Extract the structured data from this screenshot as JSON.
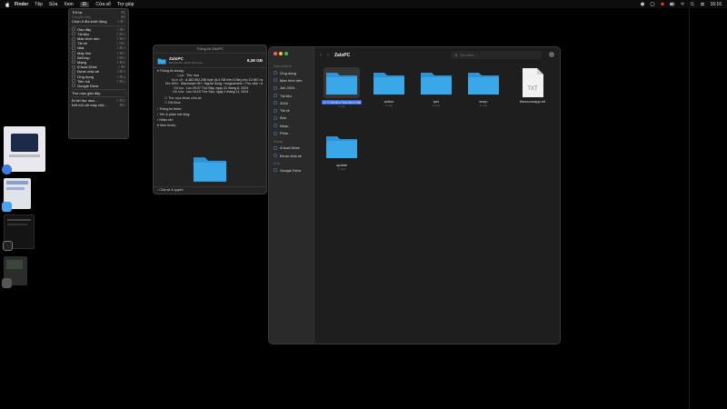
{
  "menubar": {
    "app": "Finder",
    "items": [
      "Tệp",
      "Sửa",
      "Xem",
      "Đi",
      "Cửa sổ",
      "Trợ giúp"
    ],
    "active_index": 3,
    "time": "16:16"
  },
  "go_menu": {
    "rows": [
      {
        "label": "Trở lại",
        "shortcut": "⌘[",
        "dim": false,
        "icon": ""
      },
      {
        "label": "Chuyển tiếp",
        "shortcut": "⌘]",
        "dim": true,
        "icon": ""
      },
      {
        "label": "Chọn ổ đĩa khởi động",
        "shortcut": "⇧⌘↑",
        "dim": false,
        "icon": ""
      },
      {
        "sep": true
      },
      {
        "label": "Gần đây",
        "shortcut": "⇧⌘F",
        "dim": false,
        "icon": "clock-icon"
      },
      {
        "label": "Tài liệu",
        "shortcut": "⇧⌘O",
        "dim": false,
        "icon": "document-icon"
      },
      {
        "label": "Màn hình nền",
        "shortcut": "⇧⌘D",
        "dim": false,
        "icon": "desktop-icon"
      },
      {
        "label": "Tải về",
        "shortcut": "⌥⌘L",
        "dim": false,
        "icon": "download-icon"
      },
      {
        "label": "Nhà",
        "shortcut": "⇧⌘H",
        "dim": false,
        "icon": "home-icon"
      },
      {
        "label": "Máy tính",
        "shortcut": "⇧⌘C",
        "dim": false,
        "icon": "computer-icon"
      },
      {
        "label": "AirDrop",
        "shortcut": "⇧⌘R",
        "dim": false,
        "icon": "airdrop-icon"
      },
      {
        "label": "Mạng",
        "shortcut": "⇧⌘K",
        "dim": false,
        "icon": "network-icon"
      },
      {
        "label": "iCloud Drive",
        "shortcut": "⇧⌘I",
        "dim": false,
        "icon": "cloud-icon"
      },
      {
        "label": "Được chia sẻ",
        "shortcut": "⇧⌘S",
        "dim": false,
        "icon": "shared-folder-icon"
      },
      {
        "label": "Ứng dụng",
        "shortcut": "⇧⌘A",
        "dim": false,
        "icon": "apps-icon"
      },
      {
        "label": "Tiện ích",
        "shortcut": "⇧⌘U",
        "dim": false,
        "icon": "utilities-icon"
      },
      {
        "label": "Google Drive",
        "shortcut": "",
        "dim": false,
        "icon": "drive-icon"
      },
      {
        "sep": true
      },
      {
        "label": "Thư mục gần đây",
        "shortcut": "›",
        "dim": false,
        "icon": ""
      },
      {
        "sep": true
      },
      {
        "label": "Đi tới thư mục...",
        "shortcut": "⇧⌘G",
        "dim": false,
        "icon": ""
      },
      {
        "label": "Kết nối với máy chủ...",
        "shortcut": "⌘K",
        "dim": false,
        "icon": ""
      }
    ]
  },
  "info_window": {
    "title": "Thông tin ZaloPC",
    "name": "ZaloPC",
    "modified": "Đã sửa đổi: 16:15 hôm qua",
    "size": "8,38 GB",
    "general_label": "Thông tin chung:",
    "rows": [
      {
        "k": "Loại:",
        "v": "Thư mục"
      },
      {
        "k": "Kích cỡ:",
        "v": "8.382.592.256 byte (8,4 GB trên ổ đĩa) cho 12.987 mục"
      },
      {
        "k": "Địa điểm:",
        "v": "Macintosh HD › Người dùng › tungkaiminh › Thư viện › Application Support"
      },
      {
        "k": "Đã tạo:",
        "v": "Lúc 09:37 Thứ Bảy, ngày 31 tháng 8, 2024"
      },
      {
        "k": "Đã sửa:",
        "v": "Lúc 16:15 Thứ Sáu, ngày 1 tháng 11, 2024"
      }
    ],
    "checks": [
      "Thư mục được chia sẻ",
      "Đã khóa"
    ],
    "sections": [
      "Thông tin thêm:",
      "Tên & phần mở rộng:",
      "Nhận xét:",
      "Xem trước:"
    ],
    "footer": "Chia sẻ & quyền"
  },
  "finder": {
    "title": "ZaloPC",
    "search_placeholder": "Tìm kiếm",
    "favorites_label": "Mục ưa thích",
    "favorites": [
      {
        "label": "Ứng dụng",
        "icon": "apps-icon"
      },
      {
        "label": "Màn hình nền",
        "icon": "desktop-icon"
      },
      {
        "label": "Job 2024",
        "icon": "folder-icon"
      },
      {
        "label": "Tài liệu",
        "icon": "document-icon"
      },
      {
        "label": "2024",
        "icon": "folder-icon"
      },
      {
        "label": "Tải về",
        "icon": "download-icon"
      },
      {
        "label": "Ảnh",
        "icon": "photo-icon"
      },
      {
        "label": "Nhạc",
        "icon": "music-icon"
      },
      {
        "label": "Phim",
        "icon": "movie-icon"
      }
    ],
    "icloud_label": "iCloud",
    "icloud": [
      {
        "label": "iCloud Drive",
        "icon": "cloud-icon"
      },
      {
        "label": "Được chia sẻ",
        "icon": "shared-folder-icon"
      }
    ],
    "locations_label": "Vị trí",
    "locations": [
      {
        "label": "Google Drive",
        "icon": "drive-icon"
      }
    ],
    "items": [
      {
        "name": "2270305847862691098",
        "count": "2 mục",
        "kind": "folder",
        "selected": true
      },
      {
        "name": "action",
        "count": "1 mục",
        "kind": "folder",
        "selected": false
      },
      {
        "name": "qos",
        "count": "2 mục",
        "kind": "folder",
        "selected": false
      },
      {
        "name": "temp",
        "count": "1 mục",
        "kind": "folder",
        "selected": false
      },
      {
        "name": "timezoneapp.txt",
        "count": "",
        "kind": "txt",
        "selected": false
      },
      {
        "name": "update",
        "count": "1 mục",
        "kind": "folder",
        "selected": false
      }
    ],
    "txt_label": "TXT"
  },
  "colors": {
    "folder": "#3aa8e8",
    "folder_tab": "#2e93d6",
    "selection": "#2a63d6",
    "close": "#ff5f57",
    "min": "#febc2e",
    "max": "#28c840"
  }
}
